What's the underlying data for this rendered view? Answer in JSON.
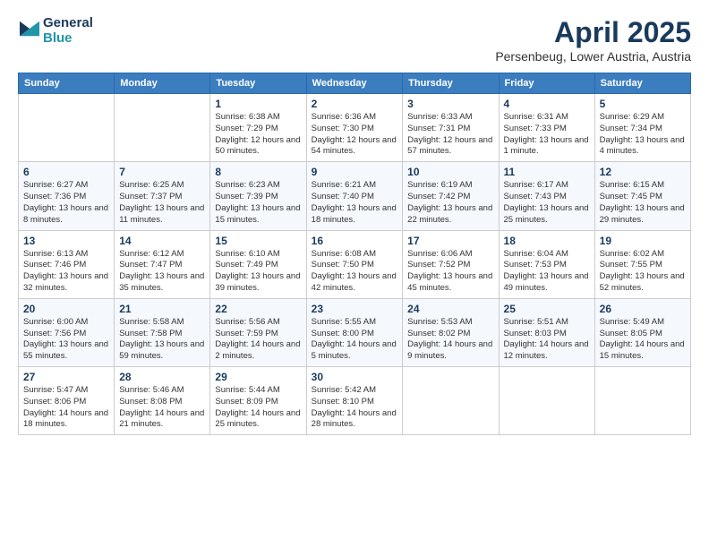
{
  "logo": {
    "line1": "General",
    "line2": "Blue"
  },
  "title": "April 2025",
  "subtitle": "Persenbeug, Lower Austria, Austria",
  "weekdays": [
    "Sunday",
    "Monday",
    "Tuesday",
    "Wednesday",
    "Thursday",
    "Friday",
    "Saturday"
  ],
  "weeks": [
    [
      {
        "day": "",
        "info": ""
      },
      {
        "day": "",
        "info": ""
      },
      {
        "day": "1",
        "info": "Sunrise: 6:38 AM\nSunset: 7:29 PM\nDaylight: 12 hours and 50 minutes."
      },
      {
        "day": "2",
        "info": "Sunrise: 6:36 AM\nSunset: 7:30 PM\nDaylight: 12 hours and 54 minutes."
      },
      {
        "day": "3",
        "info": "Sunrise: 6:33 AM\nSunset: 7:31 PM\nDaylight: 12 hours and 57 minutes."
      },
      {
        "day": "4",
        "info": "Sunrise: 6:31 AM\nSunset: 7:33 PM\nDaylight: 13 hours and 1 minute."
      },
      {
        "day": "5",
        "info": "Sunrise: 6:29 AM\nSunset: 7:34 PM\nDaylight: 13 hours and 4 minutes."
      }
    ],
    [
      {
        "day": "6",
        "info": "Sunrise: 6:27 AM\nSunset: 7:36 PM\nDaylight: 13 hours and 8 minutes."
      },
      {
        "day": "7",
        "info": "Sunrise: 6:25 AM\nSunset: 7:37 PM\nDaylight: 13 hours and 11 minutes."
      },
      {
        "day": "8",
        "info": "Sunrise: 6:23 AM\nSunset: 7:39 PM\nDaylight: 13 hours and 15 minutes."
      },
      {
        "day": "9",
        "info": "Sunrise: 6:21 AM\nSunset: 7:40 PM\nDaylight: 13 hours and 18 minutes."
      },
      {
        "day": "10",
        "info": "Sunrise: 6:19 AM\nSunset: 7:42 PM\nDaylight: 13 hours and 22 minutes."
      },
      {
        "day": "11",
        "info": "Sunrise: 6:17 AM\nSunset: 7:43 PM\nDaylight: 13 hours and 25 minutes."
      },
      {
        "day": "12",
        "info": "Sunrise: 6:15 AM\nSunset: 7:45 PM\nDaylight: 13 hours and 29 minutes."
      }
    ],
    [
      {
        "day": "13",
        "info": "Sunrise: 6:13 AM\nSunset: 7:46 PM\nDaylight: 13 hours and 32 minutes."
      },
      {
        "day": "14",
        "info": "Sunrise: 6:12 AM\nSunset: 7:47 PM\nDaylight: 13 hours and 35 minutes."
      },
      {
        "day": "15",
        "info": "Sunrise: 6:10 AM\nSunset: 7:49 PM\nDaylight: 13 hours and 39 minutes."
      },
      {
        "day": "16",
        "info": "Sunrise: 6:08 AM\nSunset: 7:50 PM\nDaylight: 13 hours and 42 minutes."
      },
      {
        "day": "17",
        "info": "Sunrise: 6:06 AM\nSunset: 7:52 PM\nDaylight: 13 hours and 45 minutes."
      },
      {
        "day": "18",
        "info": "Sunrise: 6:04 AM\nSunset: 7:53 PM\nDaylight: 13 hours and 49 minutes."
      },
      {
        "day": "19",
        "info": "Sunrise: 6:02 AM\nSunset: 7:55 PM\nDaylight: 13 hours and 52 minutes."
      }
    ],
    [
      {
        "day": "20",
        "info": "Sunrise: 6:00 AM\nSunset: 7:56 PM\nDaylight: 13 hours and 55 minutes."
      },
      {
        "day": "21",
        "info": "Sunrise: 5:58 AM\nSunset: 7:58 PM\nDaylight: 13 hours and 59 minutes."
      },
      {
        "day": "22",
        "info": "Sunrise: 5:56 AM\nSunset: 7:59 PM\nDaylight: 14 hours and 2 minutes."
      },
      {
        "day": "23",
        "info": "Sunrise: 5:55 AM\nSunset: 8:00 PM\nDaylight: 14 hours and 5 minutes."
      },
      {
        "day": "24",
        "info": "Sunrise: 5:53 AM\nSunset: 8:02 PM\nDaylight: 14 hours and 9 minutes."
      },
      {
        "day": "25",
        "info": "Sunrise: 5:51 AM\nSunset: 8:03 PM\nDaylight: 14 hours and 12 minutes."
      },
      {
        "day": "26",
        "info": "Sunrise: 5:49 AM\nSunset: 8:05 PM\nDaylight: 14 hours and 15 minutes."
      }
    ],
    [
      {
        "day": "27",
        "info": "Sunrise: 5:47 AM\nSunset: 8:06 PM\nDaylight: 14 hours and 18 minutes."
      },
      {
        "day": "28",
        "info": "Sunrise: 5:46 AM\nSunset: 8:08 PM\nDaylight: 14 hours and 21 minutes."
      },
      {
        "day": "29",
        "info": "Sunrise: 5:44 AM\nSunset: 8:09 PM\nDaylight: 14 hours and 25 minutes."
      },
      {
        "day": "30",
        "info": "Sunrise: 5:42 AM\nSunset: 8:10 PM\nDaylight: 14 hours and 28 minutes."
      },
      {
        "day": "",
        "info": ""
      },
      {
        "day": "",
        "info": ""
      },
      {
        "day": "",
        "info": ""
      }
    ]
  ]
}
